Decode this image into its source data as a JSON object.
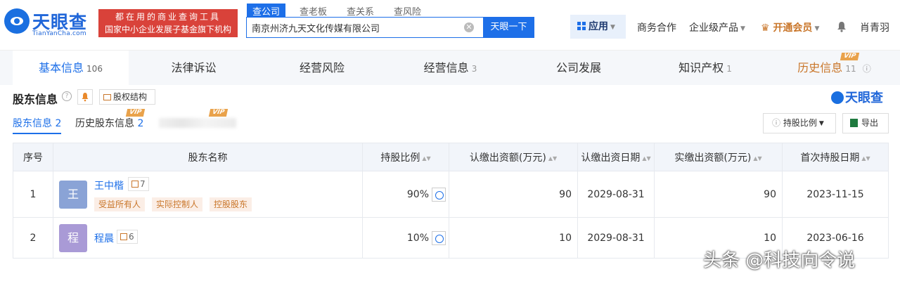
{
  "brand": {
    "name": "天眼查",
    "sub": "TianYanCha.com"
  },
  "slogan": {
    "line1": "都在用的商业查询工具",
    "line2": "国家中小企业发展子基金旗下机构"
  },
  "search": {
    "tabs": [
      "查公司",
      "查老板",
      "查关系",
      "查风险"
    ],
    "value": "南京州济九天文化传媒有限公司",
    "button": "天眼一下"
  },
  "nav": {
    "app": "应用",
    "biz": "商务合作",
    "enterprise": "企业级产品",
    "vip": "开通会员",
    "user": "肖青羽"
  },
  "tabs": [
    {
      "label": "基本信息",
      "count": "106"
    },
    {
      "label": "法律诉讼",
      "count": ""
    },
    {
      "label": "经营风险",
      "count": ""
    },
    {
      "label": "经营信息",
      "count": "3"
    },
    {
      "label": "公司发展",
      "count": ""
    },
    {
      "label": "知识产权",
      "count": "1"
    },
    {
      "label": "历史信息",
      "count": "11"
    }
  ],
  "vip_badge": "VIP",
  "section": {
    "title": "股东信息",
    "equity_btn": "股权结构",
    "brand": "天眼查"
  },
  "subtabs": [
    {
      "label": "股东信息",
      "count": "2"
    },
    {
      "label": "历史股东信息",
      "count": "2"
    }
  ],
  "toolbar": {
    "ratio": "持股比例",
    "export": "导出"
  },
  "table": {
    "headers": [
      "序号",
      "股东名称",
      "持股比例",
      "认缴出资额(万元)",
      "认缴出资日期",
      "实缴出资额(万元)",
      "首次持股日期"
    ],
    "rows": [
      {
        "idx": "1",
        "avatar": "王",
        "name": "王中楷",
        "links": "7",
        "tags": [
          "受益所有人",
          "实际控制人",
          "控股股东"
        ],
        "ratio": "90%",
        "sub_amount": "90",
        "sub_date": "2029-08-31",
        "paid": "90",
        "first_date": "2023-11-15"
      },
      {
        "idx": "2",
        "avatar": "程",
        "name": "程晨",
        "links": "6",
        "tags": [],
        "ratio": "10%",
        "sub_amount": "10",
        "sub_date": "2029-08-31",
        "paid": "10",
        "first_date": "2023-06-16"
      }
    ]
  },
  "watermark": "头条 @科技向令说",
  "colors": {
    "primary": "#1d6fe8",
    "vip": "#c9762a",
    "slogan_bg": "#d9423a",
    "avatar1": "#8aa3d6",
    "avatar2": "#a99ad6"
  }
}
